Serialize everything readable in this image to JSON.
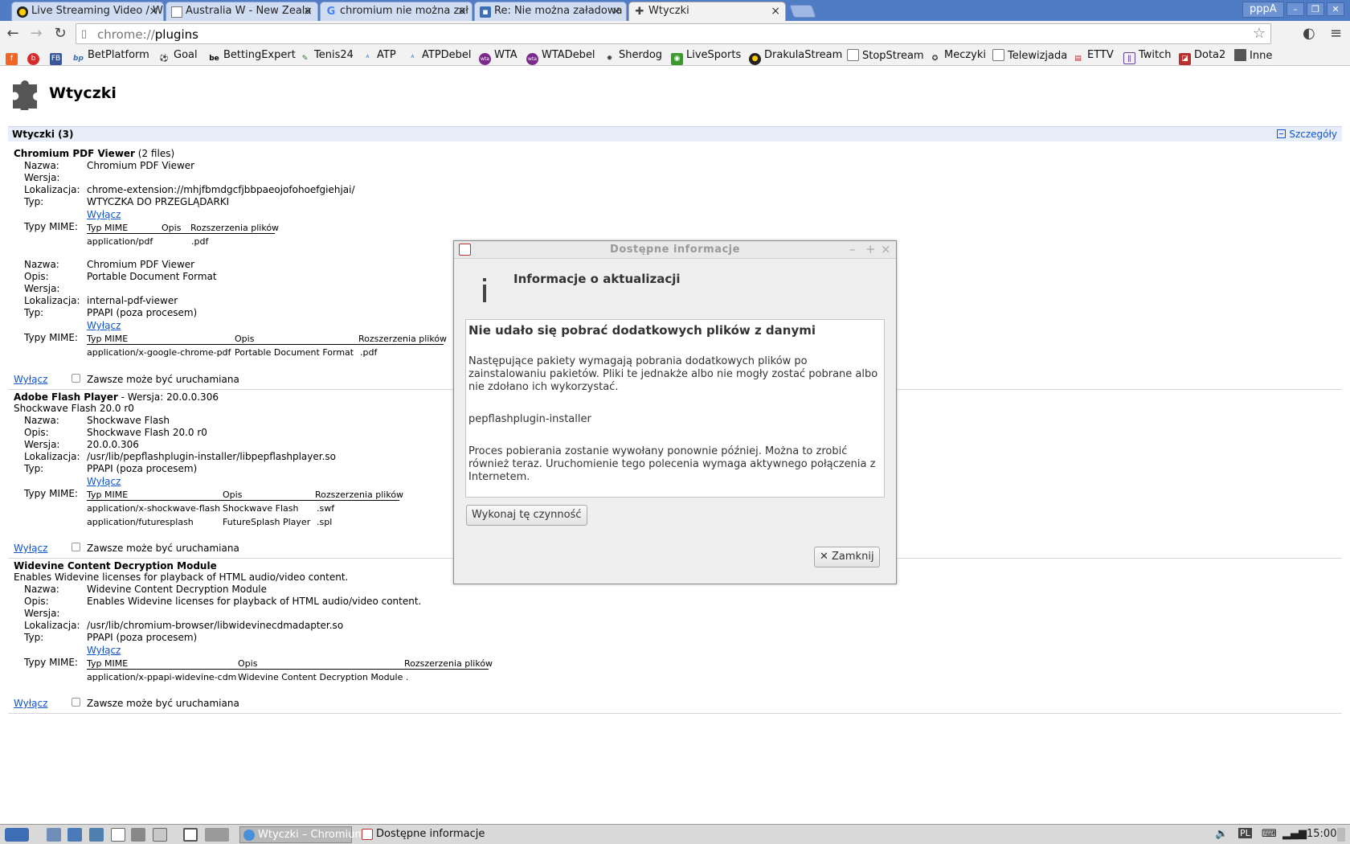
{
  "tabs": [
    {
      "label": "Live Streaming Video / W",
      "icon": "batman-icon"
    },
    {
      "label": "Australia W - New Zeala",
      "icon": "page-icon"
    },
    {
      "label": "chromium nie można zał",
      "icon": "google-icon"
    },
    {
      "label": "Re: Nie można załadowa",
      "icon": "forum-icon"
    },
    {
      "label": "Wtyczki",
      "icon": "puzzle-icon"
    }
  ],
  "profile_name": "pppA",
  "omnibox": {
    "scheme": "chrome://",
    "host": "plugins"
  },
  "bookmarks": [
    {
      "label": "",
      "icon": "f-icon"
    },
    {
      "label": "",
      "icon": "fb-icon"
    },
    {
      "label": "FB",
      "icon": "fb-square-icon"
    },
    {
      "label": "BetPlatform",
      "icon": "bp-icon"
    },
    {
      "label": "Goal",
      "icon": "ball-icon"
    },
    {
      "label": "BettingExpert",
      "icon": "be-icon"
    },
    {
      "label": "Tenis24",
      "icon": "pen-icon"
    },
    {
      "label": "ATP",
      "icon": "atp-icon"
    },
    {
      "label": "ATPDebel",
      "icon": "atp-icon"
    },
    {
      "label": "WTA",
      "icon": "wta-icon"
    },
    {
      "label": "WTADebel",
      "icon": "wta-icon"
    },
    {
      "label": "Sherdog",
      "icon": "sherdog-icon"
    },
    {
      "label": "LiveSports",
      "icon": "livesports-icon"
    },
    {
      "label": "DrakulaStream",
      "icon": "batman-icon"
    },
    {
      "label": "StopStream",
      "icon": "page-icon"
    },
    {
      "label": "Meczyki",
      "icon": "meczyki-icon"
    },
    {
      "label": "Telewizjada",
      "icon": "page-icon"
    },
    {
      "label": "ETTV",
      "icon": "ettv-icon"
    },
    {
      "label": "Twitch",
      "icon": "twitch-icon"
    },
    {
      "label": "Dota2",
      "icon": "dota-icon"
    },
    {
      "label": "Inne",
      "icon": "folder-icon"
    }
  ],
  "page": {
    "title": "Wtyczki",
    "section_title": "Wtyczki (3)",
    "details_link": "Szczegóły"
  },
  "labels": {
    "name": "Nazwa:",
    "version": "Wersja:",
    "location": "Lokalizacja:",
    "type": "Typ:",
    "description": "Opis:",
    "mime_types": "Typy MIME:",
    "col_mime": "Typ MIME",
    "col_desc": "Opis",
    "col_ext": "Rozszerzenia plików",
    "disable": "Wyłącz",
    "always_allowed": "Zawsze może być uruchamiana"
  },
  "plugins": [
    {
      "title": "Chromium PDF Viewer",
      "title_suffix": "(2 files)",
      "files": [
        {
          "name": "Chromium PDF Viewer",
          "description": null,
          "version": "",
          "location": "chrome-extension://mhjfbmdgcfjbbpaeojofohoefgiehjai/",
          "type": "WTYCZKA DO PRZEGLĄDARKI",
          "mimes": [
            {
              "mime": "application/pdf",
              "desc": "",
              "ext": ".pdf"
            }
          ]
        },
        {
          "name": "Chromium PDF Viewer",
          "description": "Portable Document Format",
          "version": "",
          "location": "internal-pdf-viewer",
          "type": "PPAPI (poza procesem)",
          "mimes": [
            {
              "mime": "application/x-google-chrome-pdf",
              "desc": "Portable Document Format",
              "ext": ".pdf"
            }
          ]
        }
      ]
    },
    {
      "title": "Adobe Flash Player",
      "title_suffix": "- Wersja: 20.0.0.306",
      "subtitle": "Shockwave Flash 20.0 r0",
      "files": [
        {
          "name": "Shockwave Flash",
          "description": "Shockwave Flash 20.0 r0",
          "version": "20.0.0.306",
          "location": "/usr/lib/pepflashplugin-installer/libpepflashplayer.so",
          "type": "PPAPI (poza procesem)",
          "mimes": [
            {
              "mime": "application/x-shockwave-flash",
              "desc": "Shockwave Flash",
              "ext": ".swf"
            },
            {
              "mime": "application/futuresplash",
              "desc": "FutureSplash Player",
              "ext": ".spl"
            }
          ]
        }
      ]
    },
    {
      "title": "Widevine Content Decryption Module",
      "title_suffix": "",
      "subtitle": "Enables Widevine licenses for playback of HTML audio/video content.",
      "files": [
        {
          "name": "Widevine Content Decryption Module",
          "description": "Enables Widevine licenses for playback of HTML audio/video content.",
          "version": "",
          "location": "/usr/lib/chromium-browser/libwidevinecdmadapter.so",
          "type": "PPAPI (poza procesem)",
          "mimes": [
            {
              "mime": "application/x-ppapi-widevine-cdm",
              "desc": "Widevine Content Decryption Module",
              "ext": "."
            }
          ]
        }
      ]
    }
  ],
  "dialog": {
    "window_title": "Dostępne informacje",
    "heading": "Informacje o aktualizacji",
    "box_heading": "Nie udało się pobrać dodatkowych plików z danymi",
    "para1": "Następujące pakiety wymagają pobrania dodatkowych plików po zainstalowaniu pakietów. Pliki te jednakże albo nie mogły zostać pobrane albo nie zdołano ich wykorzystać.",
    "package": "pepflashplugin-installer",
    "para2": "Proces pobierania zostanie wywołany ponownie później. Można to zrobić również teraz. Uruchomienie tego polecenia wymaga aktywnego połączenia z Internetem.",
    "action_button": "Wykonaj tę czynność",
    "close_button": "Zamknij"
  },
  "taskbar": {
    "tasks": [
      {
        "label": "Wtyczki – Chromium",
        "active": true
      },
      {
        "label": "Dostępne informacje",
        "active": false
      }
    ],
    "keyboard_layout": "PL",
    "clock": "15:00"
  },
  "colors": {
    "tabstrip": "#4f7cc4",
    "link": "#1155cc",
    "section_header": "#e8eef9"
  }
}
